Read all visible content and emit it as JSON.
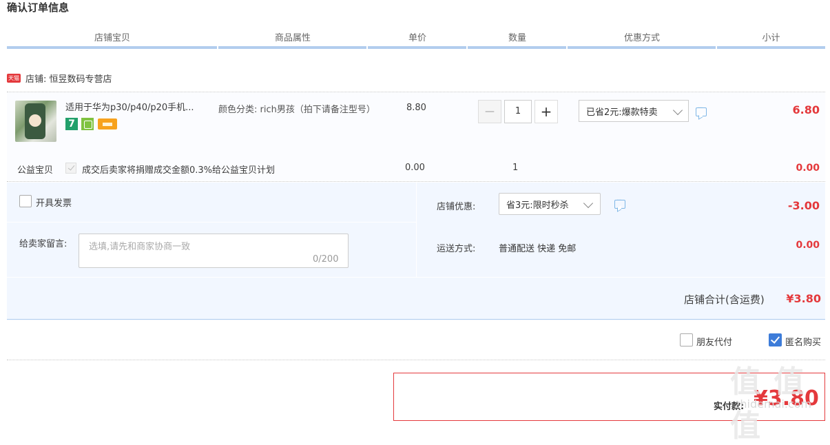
{
  "page_title": "确认订单信息",
  "columns": [
    "店铺宝贝",
    "商品属性",
    "单价",
    "数量",
    "优惠方式",
    "小计"
  ],
  "shop": {
    "badge": "天猫",
    "name": "店铺: 恒昱数码专营店"
  },
  "item": {
    "title": "适用于华为p30/p40/p20手机...",
    "attr": "颜色分类: rich男孩（拍下请备注型号）",
    "price": "8.80",
    "badge_seven": "7",
    "quantity": "1",
    "minus": "—",
    "plus": "+",
    "promo": "已省2元:爆款特卖",
    "subtotal": "6.80"
  },
  "charity": {
    "label": "公益宝贝",
    "text": "成交后卖家将捐赠成交金额0.3%给公益宝贝计划",
    "price": "0.00",
    "quantity": "1",
    "subtotal": "0.00"
  },
  "options": {
    "invoice_label": "开具发票",
    "message_label": "给卖家留言:",
    "message_placeholder": "选填,请先和商家协商一致",
    "message_count": "0/200",
    "shop_discount_label": "店铺优惠:",
    "shop_discount_value": "省3元:限时秒杀",
    "shop_discount_amount": "-3.00",
    "shipping_label": "运送方式:",
    "shipping_value": "普通配送 快递 免邮",
    "shipping_amount": "0.00"
  },
  "total": {
    "label": "店铺合计(含运费)",
    "value": "¥3.80"
  },
  "extras": {
    "friend_pay": "朋友代付",
    "anonymous": "匿名购买"
  },
  "pay": {
    "label": "实付款:",
    "value": "¥3.80"
  },
  "watermark": "值 值 值",
  "watermark_sub": "zhidemai.com",
  "colors": {
    "accent_red": "#e4393c",
    "header_bar": "#b2cdee",
    "option_bg": "#f2f7ff",
    "checkbox_blue": "#3d7cd9"
  }
}
